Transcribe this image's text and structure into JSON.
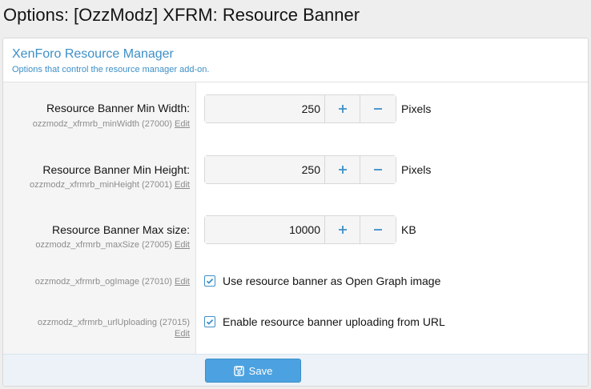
{
  "page": {
    "title": "Options: [OzzModz] XFRM: Resource Banner"
  },
  "block": {
    "title": "XenForo Resource Manager",
    "description": "Options that control the resource manager add-on."
  },
  "options": {
    "min_width": {
      "label": "Resource Banner Min Width:",
      "hint": "ozzmodz_xfrmrb_minWidth (27000)",
      "edit": "Edit",
      "value": "250",
      "unit": "Pixels"
    },
    "min_height": {
      "label": "Resource Banner Min Height:",
      "hint": "ozzmodz_xfrmrb_minHeight (27001)",
      "edit": "Edit",
      "value": "250",
      "unit": "Pixels"
    },
    "max_size": {
      "label": "Resource Banner Max size:",
      "hint": "ozzmodz_xfrmrb_maxSize (27005)",
      "edit": "Edit",
      "value": "10000",
      "unit": "KB"
    },
    "og_image": {
      "hint": "ozzmodz_xfrmrb_ogImage (27010)",
      "edit": "Edit",
      "checked": true,
      "label": "Use resource banner as Open Graph image"
    },
    "url_uploading": {
      "hint": "ozzmodz_xfrmrb_urlUploading (27015)",
      "edit": "Edit",
      "checked": true,
      "label": "Enable resource banner uploading from URL"
    }
  },
  "footer": {
    "save_label": "Save"
  },
  "icons": {
    "plus": "plus-icon",
    "minus": "minus-icon",
    "save": "save-icon",
    "check": "check-icon"
  },
  "colors": {
    "accent": "#3d8fc7",
    "button": "#4ca2e0"
  }
}
